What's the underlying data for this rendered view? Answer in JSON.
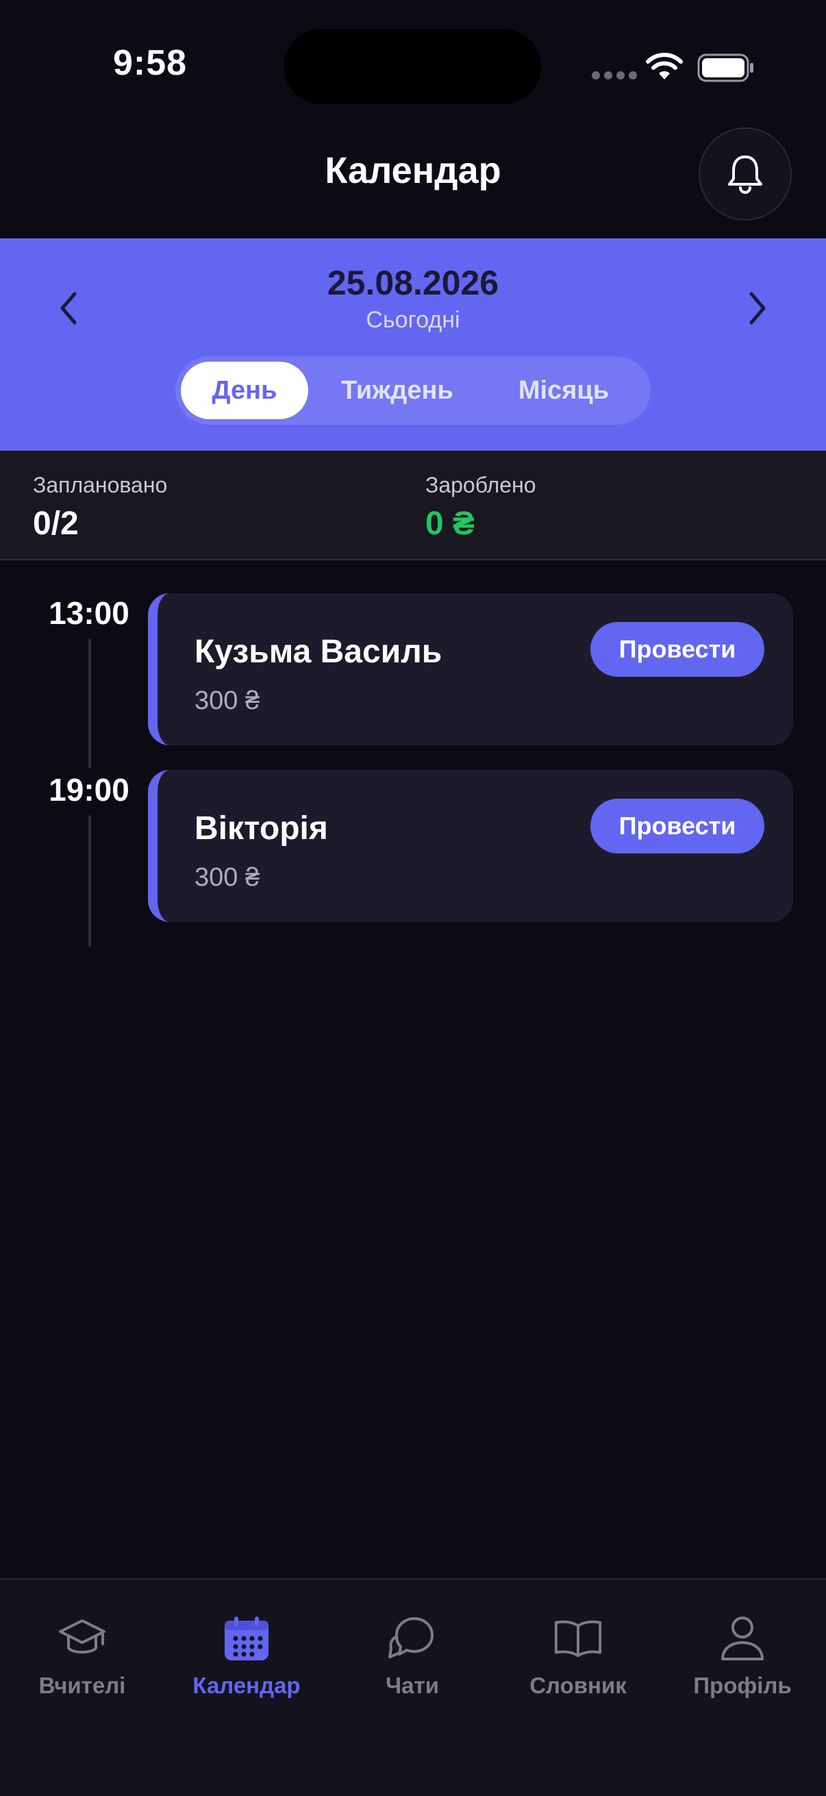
{
  "status_bar": {
    "time": "9:58"
  },
  "header": {
    "title": "Календар"
  },
  "date_nav": {
    "date": "25.08.2026",
    "subtitle": "Сьогодні",
    "views": [
      "День",
      "Тиждень",
      "Місяць"
    ],
    "active_view": "День"
  },
  "stats": {
    "planned_label": "Заплановано",
    "planned_value": "0/2",
    "earned_label": "Зароблено",
    "earned_value": "0 ₴"
  },
  "lessons": [
    {
      "time": "13:00",
      "name": "Кузьма Василь",
      "price": "300 ₴",
      "action": "Провести"
    },
    {
      "time": "19:00",
      "name": "Вікторія",
      "price": "300 ₴",
      "action": "Провести"
    }
  ],
  "tabs": [
    {
      "label": "Вчителі",
      "icon": "graduation-cap-icon"
    },
    {
      "label": "Календар",
      "icon": "calendar-icon"
    },
    {
      "label": "Чати",
      "icon": "chat-bubbles-icon"
    },
    {
      "label": "Словник",
      "icon": "book-icon"
    },
    {
      "label": "Профіль",
      "icon": "user-icon"
    }
  ],
  "active_tab": "Календар",
  "colors": {
    "background": "#0c0b14",
    "accent": "#6366f1",
    "earned_green": "#22c55e",
    "card": "#1d1b2b"
  }
}
